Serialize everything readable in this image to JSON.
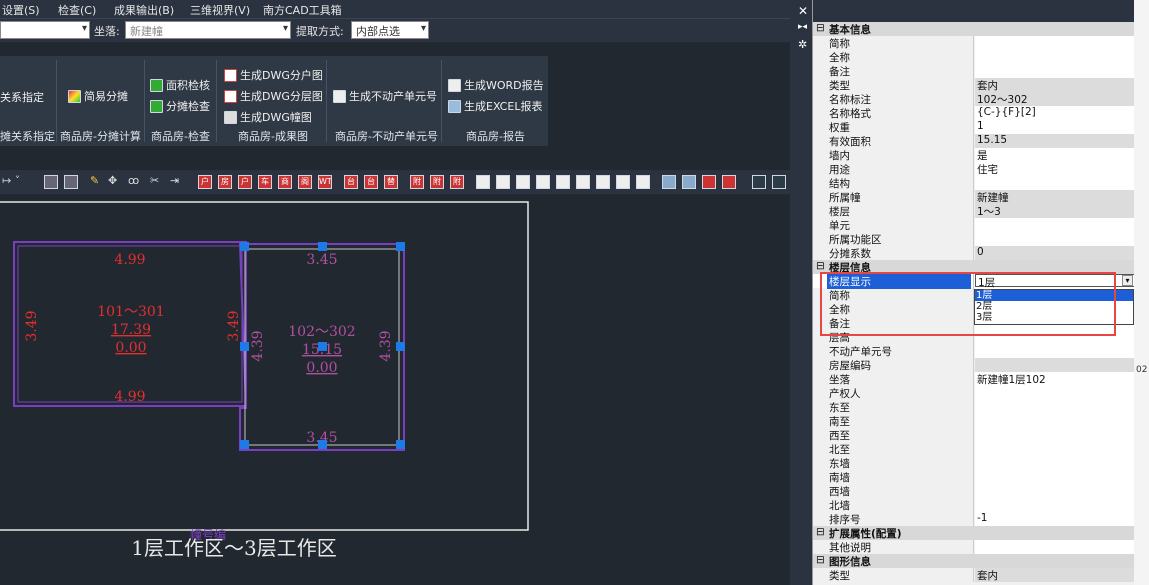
{
  "menu": [
    "设置(S)",
    "检查(C)",
    "成果输出(B)",
    "三维视界(V)",
    "南方CAD工具箱"
  ],
  "options": {
    "location_label": "坐落:",
    "location_value": "新建幢",
    "extract_label": "提取方式:",
    "extract_value": "内部点选"
  },
  "ribbon": {
    "group1": {
      "b1": "关系指定",
      "label": "摊关系指定"
    },
    "group2": {
      "b1": "简易分摊",
      "label": "商品房-分摊计算"
    },
    "group3": {
      "b1": "面积检核",
      "b2": "分摊检查",
      "label": "商品房-检查"
    },
    "group4": {
      "b1": "生成DWG分户图",
      "b2": "生成DWG分层图",
      "b3": "生成DWG幢图",
      "label": "商品房-成果图"
    },
    "group5": {
      "b1": "生成不动产单元号",
      "label": "商品房-不动产单元号"
    },
    "group6": {
      "b1": "生成WORD报告",
      "b2": "生成EXCEL报表",
      "label": "商品房-报告"
    }
  },
  "toolbar_glyphs": [
    "户",
    "房",
    "户",
    "车",
    "商",
    "阁",
    "WT",
    "台",
    "台",
    "替",
    "附",
    "附",
    "附"
  ],
  "drawing": {
    "left_room": {
      "top_dim": "4.99",
      "bottom_dim": "4.99",
      "left_dim": "3.49",
      "right_dim": "3.49",
      "name": "101～301",
      "area": "17.39",
      "sub": "0.00"
    },
    "right_room": {
      "top_dim": "3.45",
      "bottom_dim": "3.45",
      "left_dim": "4.39",
      "right_dim": "4.39",
      "name": "102～302",
      "area": "15.15",
      "sub": "0.00"
    },
    "caption": "1层工作区～3层工作区",
    "overlay": "幢号编"
  },
  "props": {
    "cat_basic": "基本信息",
    "rows_basic": [
      {
        "k": "简称",
        "v": ""
      },
      {
        "k": "全称",
        "v": ""
      },
      {
        "k": "备注",
        "v": ""
      },
      {
        "k": "类型",
        "v": "套内"
      },
      {
        "k": "名称标注",
        "v": "102～302"
      },
      {
        "k": "名称格式",
        "v": "{C-}{F}[2]"
      },
      {
        "k": "权重",
        "v": "1"
      },
      {
        "k": "有效面积",
        "v": "15.15"
      },
      {
        "k": "墙内",
        "v": "是"
      },
      {
        "k": "用途",
        "v": "住宅"
      },
      {
        "k": "结构",
        "v": ""
      },
      {
        "k": "所属幢",
        "v": "新建幢"
      },
      {
        "k": "楼层",
        "v": "1～3"
      },
      {
        "k": "单元",
        "v": ""
      },
      {
        "k": "所属功能区",
        "v": ""
      },
      {
        "k": "分摊系数",
        "v": "0"
      }
    ],
    "cat_floor": "楼层信息",
    "rows_floor": [
      {
        "k": "楼层显示",
        "v": "1层"
      },
      {
        "k": "简称",
        "v": ""
      },
      {
        "k": "全称",
        "v": ""
      },
      {
        "k": "备注",
        "v": ""
      },
      {
        "k": "层高",
        "v": ""
      },
      {
        "k": "不动产单元号",
        "v": ""
      },
      {
        "k": "房屋编码",
        "v": ""
      },
      {
        "k": "坐落",
        "v": "新建幢1层102"
      },
      {
        "k": "产权人",
        "v": ""
      },
      {
        "k": "东至",
        "v": ""
      },
      {
        "k": "南至",
        "v": ""
      },
      {
        "k": "西至",
        "v": ""
      },
      {
        "k": "北至",
        "v": ""
      },
      {
        "k": "东墙",
        "v": ""
      },
      {
        "k": "南墙",
        "v": ""
      },
      {
        "k": "西墙",
        "v": ""
      },
      {
        "k": "北墙",
        "v": ""
      },
      {
        "k": "排序号",
        "v": "-1"
      }
    ],
    "cat_ext": "扩展属性(配置)",
    "rows_ext": [
      {
        "k": "其他说明",
        "v": ""
      }
    ],
    "cat_shape": "图形信息",
    "rows_shape": [
      {
        "k": "类型",
        "v": "套内"
      }
    ],
    "dropdown": [
      "1层",
      "2层",
      "3层"
    ],
    "edge_text": "02"
  }
}
